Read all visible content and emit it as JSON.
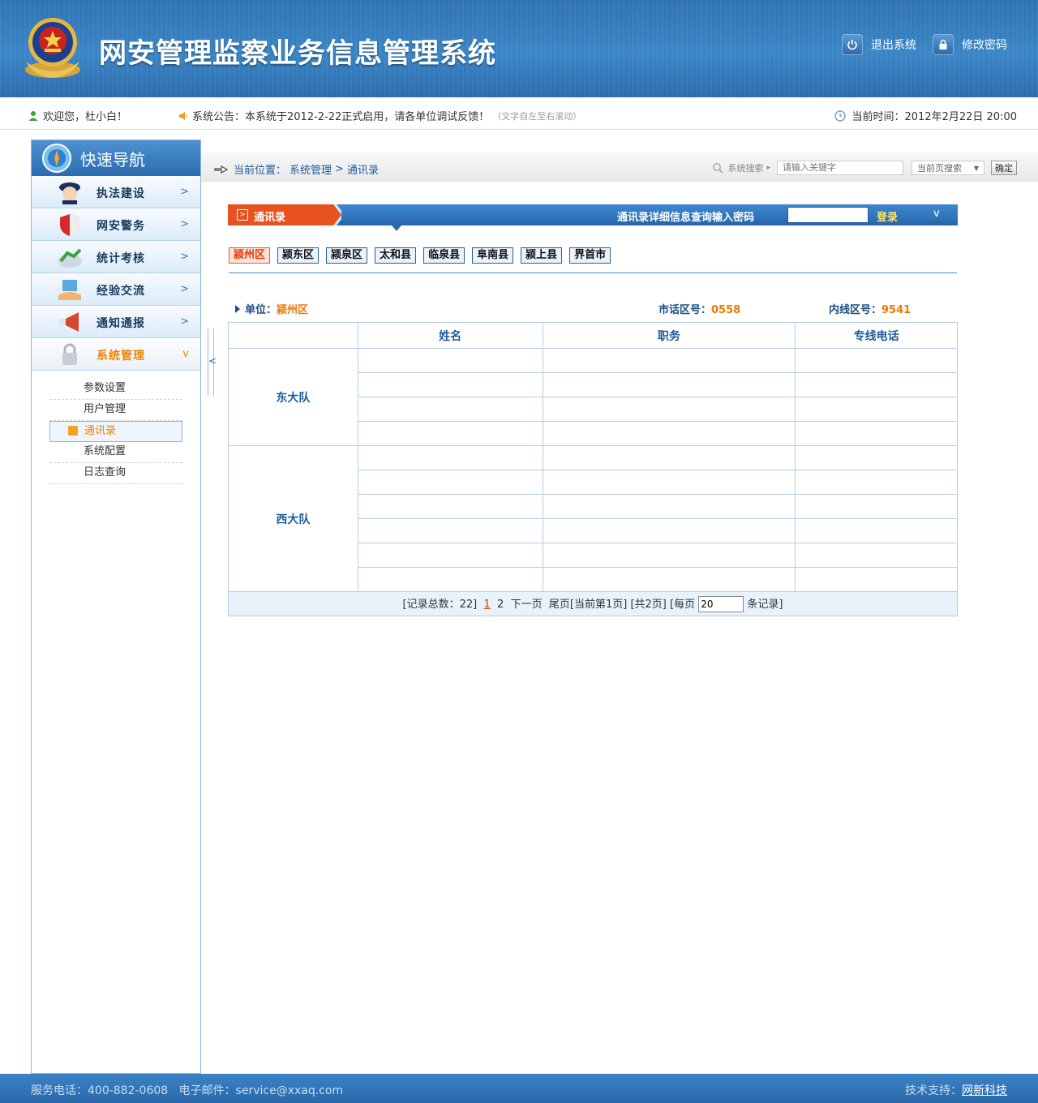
{
  "header": {
    "title": "网安管理监察业务信息管理系统",
    "logout_label": "退出系统",
    "change_password_label": "修改密码"
  },
  "infobar": {
    "welcome": "欢迎您，杜小白！",
    "notice": "系统公告：本系统于2012-2-22正式启用，请各单位调试反馈！",
    "notice_hint": "（文字自左至右滚动）",
    "time": "当前时间：2012年2月22日 20:00"
  },
  "sidebar": {
    "title": "快速导航",
    "items": [
      {
        "label": "执法建设",
        "icon": "police-officer-icon"
      },
      {
        "label": "网安警务",
        "icon": "shield-icon"
      },
      {
        "label": "统计考核",
        "icon": "chart-icon"
      },
      {
        "label": "经验交流",
        "icon": "exchange-icon"
      },
      {
        "label": "通知通报",
        "icon": "megaphone-icon"
      },
      {
        "label": "系统管理",
        "icon": "lock-icon"
      }
    ],
    "subitems": [
      "参数设置",
      "用户管理",
      "通讯录",
      "系统配置",
      "日志查询"
    ]
  },
  "breadcrumb": {
    "prefix": "当前位置：",
    "section": "系统管理",
    "sep": ">",
    "page": "通讯录"
  },
  "search": {
    "label": "系统搜索",
    "placeholder": "请输入关键字",
    "scope": "当前页搜索",
    "confirm_label": "确定"
  },
  "module": {
    "title": "通讯录",
    "password_prompt": "通讯录详细信息查询输入密码",
    "login_label": "登录"
  },
  "districts": [
    "颍州区",
    "颍东区",
    "颍泉区",
    "太和县",
    "临泉县",
    "阜南县",
    "颍上县",
    "界首市"
  ],
  "unit": {
    "label": "单位：",
    "value": "颍州区",
    "city_code_label": "市话区号：",
    "city_code": "0558",
    "ext_code_label": "内线区号：",
    "ext_code": "9541"
  },
  "table": {
    "headers": [
      "",
      "姓名",
      "职务",
      "专线电话"
    ],
    "groups": [
      {
        "name": "东大队",
        "rows": 4
      },
      {
        "name": "西大队",
        "rows": 6
      }
    ]
  },
  "pager": {
    "total": "[记录总数：22]",
    "page1": "1",
    "page2": "2",
    "next": "下一页",
    "last": "尾页",
    "current": "[当前第1页]",
    "count": "[共2页]",
    "per_page_label": "[每页",
    "per_page_value": "20",
    "per_page_suffix": "条记录]"
  },
  "footer": {
    "phone": "服务电话：400-882-0608",
    "email": "电子邮件：service@xxaq.com",
    "support_label": "技术支持：",
    "support_name": "网新科技"
  }
}
